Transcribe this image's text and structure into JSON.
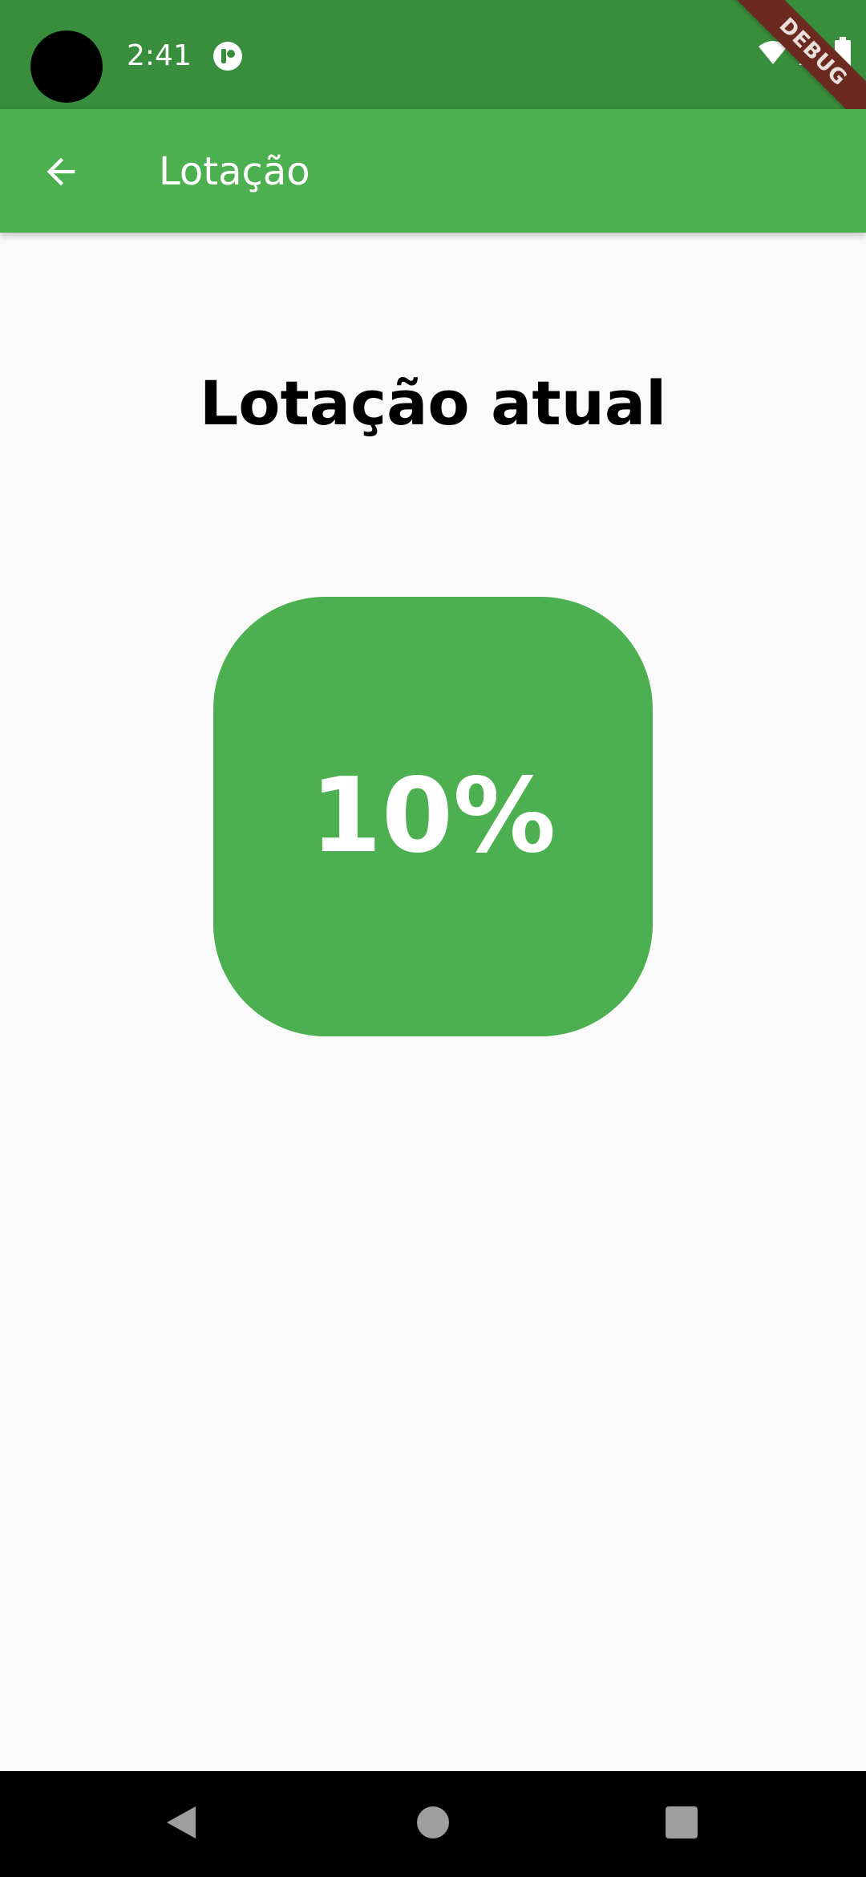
{
  "status_bar": {
    "time": "2:41",
    "color": "#388e3c",
    "icons": [
      "camera-cutout",
      "notification-icon",
      "wifi-icon",
      "signal-icon",
      "battery-icon"
    ]
  },
  "debug_banner": {
    "label": "DEBUG",
    "color": "#6b2a20"
  },
  "app_bar": {
    "title": "Lotação",
    "back_icon": "arrow-back-icon",
    "color": "#4caf50"
  },
  "main": {
    "heading": "Lotação atual",
    "occupancy": {
      "value": "10%",
      "color": "#4caf50"
    }
  },
  "nav_bar": {
    "buttons": [
      "back-triangle-icon",
      "home-circle-icon",
      "recents-square-icon"
    ]
  }
}
